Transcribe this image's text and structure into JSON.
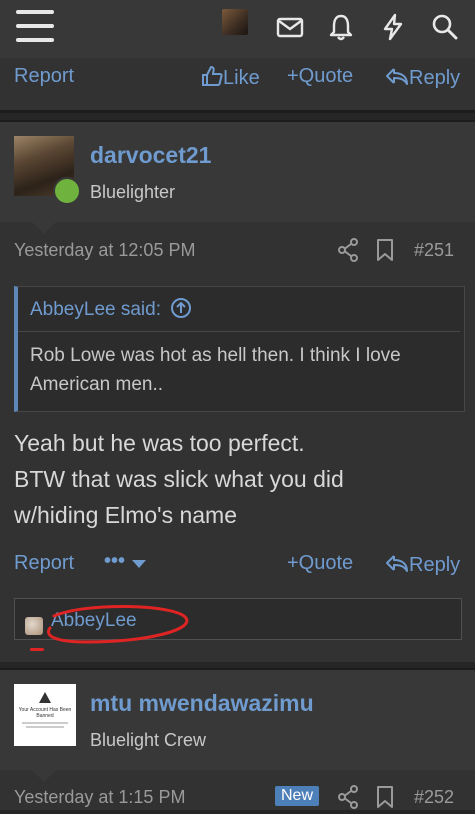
{
  "topbar": {
    "icons": [
      "menu-icon",
      "avatar",
      "envelope-icon",
      "bell-icon",
      "lightning-icon",
      "search-icon"
    ]
  },
  "prev_post_actions": {
    "report": "Report",
    "like": "Like",
    "quote": "+Quote",
    "reply": "Reply"
  },
  "post251": {
    "username": "darvocet21",
    "user_title": "Bluelighter",
    "timestamp": "Yesterday at 12:05 PM",
    "post_number": "#251",
    "quote": {
      "author": "AbbeyLee said:",
      "text": "Rob Lowe was hot as hell then. I think I love American men.."
    },
    "message_lines": [
      "Yeah but he was too perfect.",
      "BTW that was slick what you did",
      "w/hiding Elmo's name"
    ],
    "actions": {
      "report": "Report",
      "more": "•••",
      "quote": "+Quote",
      "reply": "Reply"
    },
    "reaction_user": "AbbeyLee"
  },
  "post252": {
    "username": "mtu mwendawazimu",
    "user_title": "Bluelight Crew",
    "avatar_text_title": "Your Account Has Been Banned",
    "timestamp": "Yesterday at 1:15 PM",
    "badge": "New",
    "post_number": "#252"
  },
  "colors": {
    "link": "#6f9bcf",
    "background": "#262626",
    "post_bg": "#323232",
    "header_bg": "#383838",
    "annotation": "#e02424",
    "online": "#6fb33e"
  }
}
